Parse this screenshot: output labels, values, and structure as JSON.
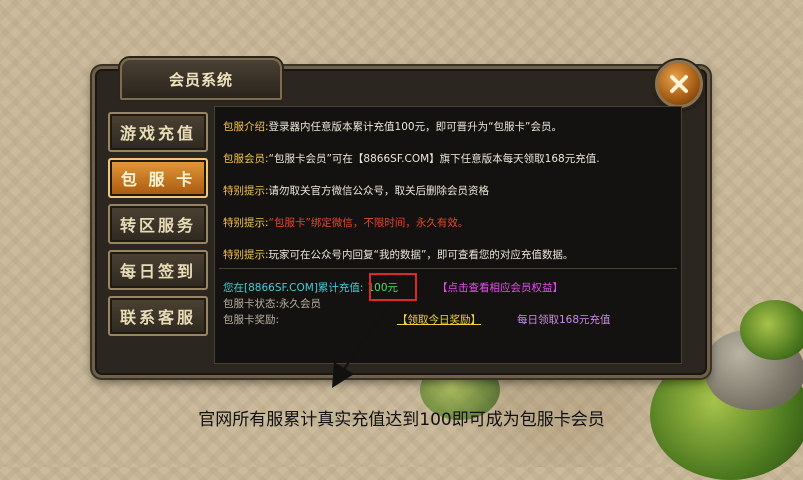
{
  "window": {
    "title": "会员系统"
  },
  "sidebar": {
    "items": [
      {
        "label": "游戏充值",
        "active": false
      },
      {
        "label": "包 服 卡",
        "active": true
      },
      {
        "label": "转区服务",
        "active": false
      },
      {
        "label": "每日签到",
        "active": false
      },
      {
        "label": "联系客服",
        "active": false
      }
    ]
  },
  "info": {
    "intro_label": "包服介绍:",
    "intro_text": "登录器内任意版本累计充值100元，即可晋升为“包服卡”会员。",
    "member_label": "包服会员:",
    "member_text": "“包服卡会员”可在【8866SF.COM】旗下任意版本每天领取168元充值.",
    "tip1_label": "特别提示:",
    "tip1_text": "请勿取关官方微信公众号，取关后删除会员资格",
    "tip2_label": "特别提示:",
    "tip2_text": "“包服卡”绑定微信，不限时间，永久有效。",
    "tip3_label": "特别提示:",
    "tip3_text": "玩家可在公众号内回复“我的数据”，即可查看您的对应充值数据。"
  },
  "status": {
    "recharge_prefix": "您在[8866SF.COM]累计充值:",
    "recharge_value": "100元",
    "view_benefits": "【点击查看相应会员权益】",
    "card_status_label": "包服卡状态:",
    "card_status_value": "永久会员",
    "reward_label": "包服卡奖励:",
    "claim_button": "【领取今日奖励】",
    "daily_note": "每日领取168元充值"
  },
  "annotation": {
    "caption": "官网所有服累计真实充值达到100即可成为包服卡会员"
  },
  "colors": {
    "accent_orange": "#c97420",
    "label_gold": "#f2c44a",
    "warning_red": "#e8432e",
    "highlight_box": "#e0262a"
  },
  "icons": {
    "close": "close-icon",
    "arrow": "arrow-down-left-icon"
  }
}
